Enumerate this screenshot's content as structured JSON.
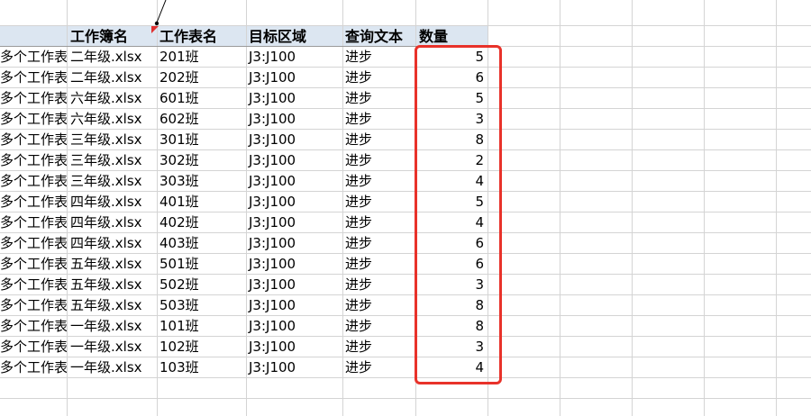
{
  "headers": [
    "工作簿名",
    "工作表名",
    "目标区域",
    "查询文本",
    "数量"
  ],
  "rows": [
    {
      "a": "多个工作表",
      "b": "二年级.xlsx",
      "c": "201班",
      "d": "J3:J100",
      "e": "进步",
      "f": "5"
    },
    {
      "a": "多个工作表",
      "b": "二年级.xlsx",
      "c": "202班",
      "d": "J3:J100",
      "e": "进步",
      "f": "6"
    },
    {
      "a": "多个工作表",
      "b": "六年级.xlsx",
      "c": "601班",
      "d": "J3:J100",
      "e": "进步",
      "f": "5"
    },
    {
      "a": "多个工作表",
      "b": "六年级.xlsx",
      "c": "602班",
      "d": "J3:J100",
      "e": "进步",
      "f": "3"
    },
    {
      "a": "多个工作表",
      "b": "三年级.xlsx",
      "c": "301班",
      "d": "J3:J100",
      "e": "进步",
      "f": "8"
    },
    {
      "a": "多个工作表",
      "b": "三年级.xlsx",
      "c": "302班",
      "d": "J3:J100",
      "e": "进步",
      "f": "2"
    },
    {
      "a": "多个工作表",
      "b": "三年级.xlsx",
      "c": "303班",
      "d": "J3:J100",
      "e": "进步",
      "f": "4"
    },
    {
      "a": "多个工作表",
      "b": "四年级.xlsx",
      "c": "401班",
      "d": "J3:J100",
      "e": "进步",
      "f": "5"
    },
    {
      "a": "多个工作表",
      "b": "四年级.xlsx",
      "c": "402班",
      "d": "J3:J100",
      "e": "进步",
      "f": "4"
    },
    {
      "a": "多个工作表",
      "b": "四年级.xlsx",
      "c": "403班",
      "d": "J3:J100",
      "e": "进步",
      "f": "6"
    },
    {
      "a": "多个工作表",
      "b": "五年级.xlsx",
      "c": "501班",
      "d": "J3:J100",
      "e": "进步",
      "f": "6"
    },
    {
      "a": "多个工作表",
      "b": "五年级.xlsx",
      "c": "502班",
      "d": "J3:J100",
      "e": "进步",
      "f": "3"
    },
    {
      "a": "多个工作表",
      "b": "五年级.xlsx",
      "c": "503班",
      "d": "J3:J100",
      "e": "进步",
      "f": "8"
    },
    {
      "a": "多个工作表",
      "b": "一年级.xlsx",
      "c": "101班",
      "d": "J3:J100",
      "e": "进步",
      "f": "8"
    },
    {
      "a": "多个工作表",
      "b": "一年级.xlsx",
      "c": "102班",
      "d": "J3:J100",
      "e": "进步",
      "f": "3"
    },
    {
      "a": "多个工作表",
      "b": "一年级.xlsx",
      "c": "103班",
      "d": "J3:J100",
      "e": "进步",
      "f": "4"
    }
  ],
  "colors": {
    "highlight": "#e8322a",
    "header_bg": "#dce6f1",
    "comment_marker": "#e03030"
  }
}
